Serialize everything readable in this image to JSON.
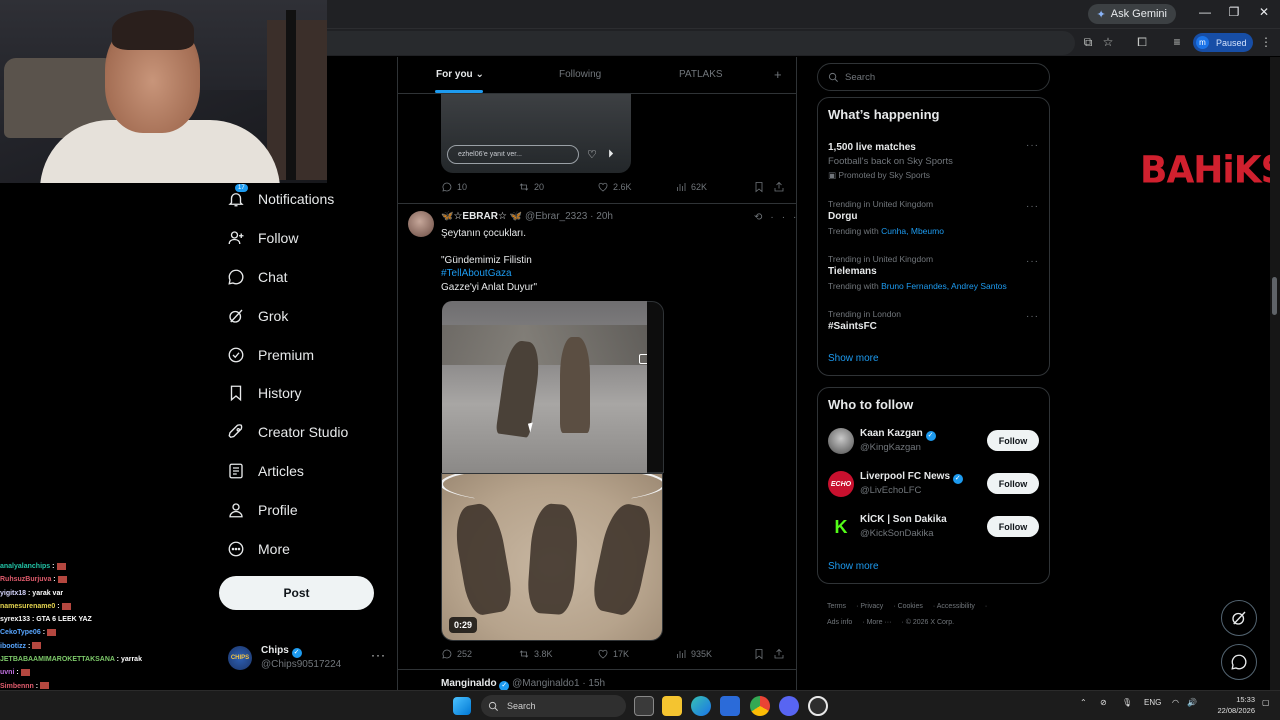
{
  "browser": {
    "gemini_label": "Ask Gemini",
    "paused_label": "Paused",
    "profile_initial": "m",
    "minimize": "—",
    "restore": "❐",
    "close": "✕"
  },
  "chat": [
    {
      "user": "analyalanchips",
      "color": "#22c3a6",
      "msg": ":",
      "emote": true
    },
    {
      "user": "RuhsuzBurjuva",
      "color": "#e05b6c",
      "msg": ":",
      "emote": true
    },
    {
      "user": "yigitx18",
      "color": "#d7d7ff",
      "msg": ": yarak var",
      "emote": false
    },
    {
      "user": "namesurename0",
      "color": "#e4d44f",
      "msg": ":",
      "emote": true
    },
    {
      "user": "syrex133",
      "color": "#ffffff",
      "msg": ": GTA 6 LEEK YAZ",
      "emote": false
    },
    {
      "user": "CekoType06",
      "color": "#58a6ff",
      "msg": ":",
      "emote": true
    },
    {
      "user": "ibootizz",
      "color": "#58a6ff",
      "msg": ":",
      "emote": true
    },
    {
      "user": "JETBABAAMIMAROKETTAKSANA",
      "color": "#7dc96a",
      "msg": ": yarrak",
      "emote": false
    },
    {
      "user": "uvni",
      "color": "#c06fe0",
      "msg": ":",
      "emote": true
    },
    {
      "user": "Simbennn",
      "color": "#e05b6c",
      "msg": ":",
      "emote": true
    },
    {
      "user": "Tunahan7117",
      "color": "#7dc96a",
      "msg": ": ONE LAN",
      "emote": false
    },
    {
      "user": "8",
      "color": "#7dc96a",
      "msg": ": SANA GİRSİN",
      "emote": false
    }
  ],
  "nav": {
    "items": [
      {
        "label": "Notifications",
        "icon": "bell-icon",
        "badge": "17"
      },
      {
        "label": "Follow",
        "icon": "person-plus-icon"
      },
      {
        "label": "Chat",
        "icon": "chat-bubble-icon"
      },
      {
        "label": "Grok",
        "icon": "grok-icon"
      },
      {
        "label": "Premium",
        "icon": "verified-badge-icon"
      },
      {
        "label": "History",
        "icon": "bookmark-icon"
      },
      {
        "label": "Creator Studio",
        "icon": "rocket-icon"
      },
      {
        "label": "Articles",
        "icon": "article-icon"
      },
      {
        "label": "Profile",
        "icon": "person-icon"
      },
      {
        "label": "More",
        "icon": "more-circle-icon"
      }
    ],
    "post_label": "Post",
    "account": {
      "name": "Chips",
      "handle": "@Chips90517224",
      "avatar_text": "CHIPS"
    }
  },
  "tabs": [
    {
      "label": "For you ⌄"
    },
    {
      "label": "Following"
    },
    {
      "label": "PATLAKS"
    }
  ],
  "tab_plus": "+",
  "top_tweet": {
    "reply_placeholder": "ezhel06'e yanıt ver...",
    "replies": "10",
    "reposts": "20",
    "likes": "2.6K",
    "views": "62K"
  },
  "tweet": {
    "name": "🦋☆EBRAR☆ 🦋",
    "handle": "@Ebrar_2323",
    "time": "· 20h",
    "text_line1": "Şeytanın çocukları.",
    "text_line2": "\"Gündemimiz Filistin",
    "hashtag": "#TellAboutGaza",
    "text_line3": "Gazze'yi Anlat Duyur\"",
    "duration": "0:29",
    "replies": "252",
    "reposts": "3.8K",
    "likes": "17K",
    "views": "935K"
  },
  "next_tweet": {
    "name": "Manginaldo",
    "handle": "@Manginaldo1",
    "time": "· 15h"
  },
  "search_placeholder": "Search",
  "happening": {
    "title": "What’s happening",
    "trends": [
      {
        "meta": "",
        "name": "1,500 live matches",
        "sub": "Football's back on Sky Sports",
        "promo": "Promoted by Sky Sports"
      },
      {
        "meta": "Trending in United Kingdom",
        "name": "Dorgu",
        "sub_prefix": "Trending with",
        "links": "Cunha, Mbeumo"
      },
      {
        "meta": "Trending in United Kingdom",
        "name": "Tielemans",
        "sub_prefix": "Trending with",
        "links": "Bruno Fernandes, Andrey Santos"
      },
      {
        "meta": "Trending in London",
        "name": "#SaintsFC"
      }
    ],
    "show_more": "Show more"
  },
  "who_to_follow": {
    "title": "Who to follow",
    "accounts": [
      {
        "name": "Kaan Kazgan",
        "handle": "@KingKazgan",
        "button": "Follow"
      },
      {
        "name": "Liverpool FC News",
        "handle": "@LivEchoLFC",
        "button": "Follow",
        "avatar_text": "ECHO"
      },
      {
        "name": "KİCK | Son Dakika",
        "handle": "@KickSonDakika",
        "button": "Follow",
        "avatar_text": "K"
      }
    ],
    "show_more": "Show more"
  },
  "footer": [
    "Terms",
    "Privacy",
    "Cookies",
    "Accessibility",
    "Ads info",
    "More ···",
    "© 2026 X Corp."
  ],
  "brand_logo": "BAHiKS",
  "taskbar": {
    "search": "Search",
    "lang": "ENG",
    "time": "15:33",
    "date": "22/08/2026"
  },
  "colors": {
    "accent": "#1d9bf0",
    "background": "#000000",
    "brand": "#d0202e"
  }
}
